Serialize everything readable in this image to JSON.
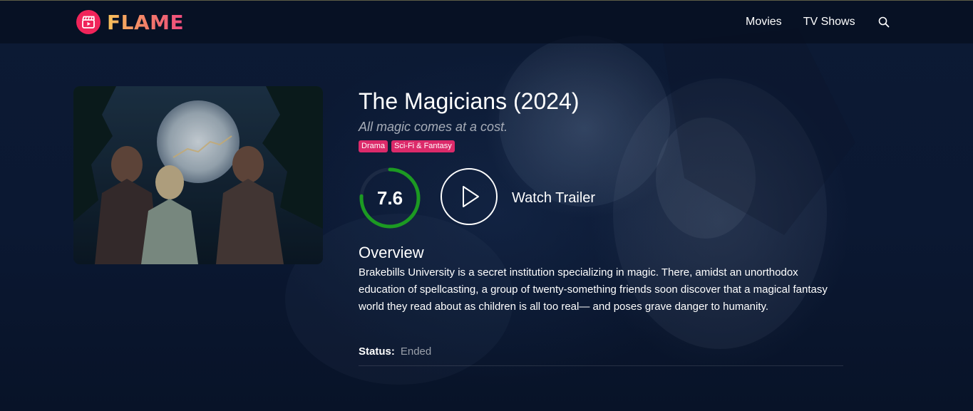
{
  "header": {
    "logo_text": "FLAME",
    "logo_icon": "clapperboard-play-icon",
    "nav": [
      {
        "label": "Movies"
      },
      {
        "label": "TV Shows"
      }
    ],
    "search_icon": "search-icon"
  },
  "show": {
    "title": "The Magicians (2024)",
    "tagline": "All magic comes at a cost.",
    "genres": [
      "Drama",
      "Sci-Fi & Fantasy"
    ],
    "rating": "7.6",
    "rating_fraction": 0.76,
    "trailer_label": "Watch Trailer",
    "overview_heading": "Overview",
    "overview": "Brakebills University is a secret institution specializing in magic. There, amidst an unorthodox education of spellcasting, a group of twenty-something friends soon discover that a magical fantasy world they read about as children is all too real— and poses grave danger to humanity.",
    "status_label": "Status:",
    "status_value": "Ended"
  },
  "colors": {
    "background": "#0b1832",
    "accent": "#dc2a6a",
    "rating_ring": "#1c9a22",
    "logo_icon_bg": "#f0245a"
  }
}
